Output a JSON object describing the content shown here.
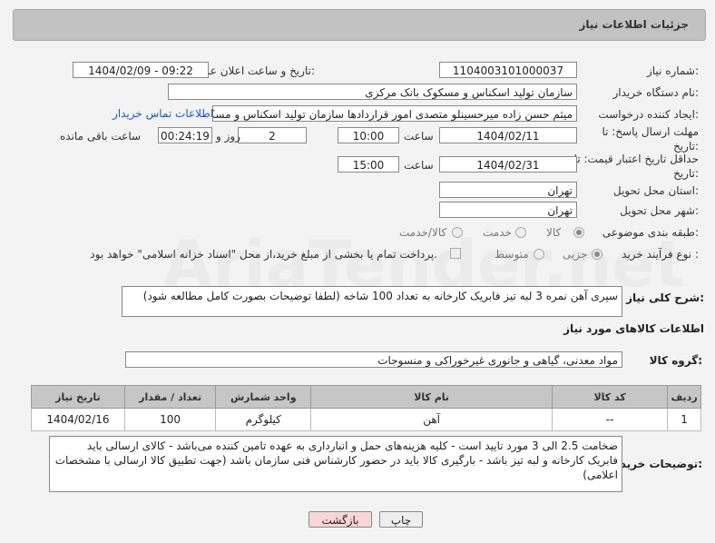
{
  "header": {
    "title": "جزئیات اطلاعات نیاز"
  },
  "form": {
    "need_number_label": "شماره نیاز:",
    "need_number": "1104003101000037",
    "announce_label": "تاریخ و ساعت اعلان عمومی:",
    "announce_value": "1404/02/09 - 09:22",
    "buyer_org_label": "نام دستگاه خریدار:",
    "buyer_org": "سازمان تولید اسکناس و مسکوک بانک مرکزی",
    "requester_label": "ایجاد کننده درخواست:",
    "requester": "میثم حسن زاده میرحسینلو متصدی امور قراردادها سازمان تولید اسکناس و مسکوک بانک مرکزی",
    "buyer_contact_link": "اطلاعات تماس خریدار",
    "deadline_label": "مهلت ارسال پاسخ: تا تاریخ:",
    "deadline_date": "1404/02/11",
    "time_label": "ساعت",
    "deadline_time": "10:00",
    "days_value": "2",
    "days_label": "روز و",
    "remaining_time": "00:24:19",
    "remaining_label": "ساعت باقی مانده",
    "validity_label": "حداقل تاریخ اعتبار قیمت: تا تاریخ:",
    "validity_date": "1404/02/31",
    "validity_time": "15:00",
    "province_label": "استان محل تحویل:",
    "province": "تهران",
    "city_label": "شهر محل تحویل:",
    "city": "تهران",
    "category_label": "طبقه بندی موضوعی:",
    "category_options": [
      "کالا",
      "خدمت",
      "کالا/خدمت"
    ],
    "process_label": "نوع فرآیند خرید :",
    "process_options": [
      "جزیی",
      "متوسط"
    ],
    "payment_note": "پرداخت تمام یا بخشی از مبلغ خرید،از محل \"اسناد خزانه اسلامی\" خواهد بود."
  },
  "description": {
    "label": "شرح کلی نیاز:",
    "text": "سپری آهن نمره 3 لبه تیز فابریک کارخانه به تعداد 100 شاخه (لطفا توضیحات بصورت کامل مطالعه شود)"
  },
  "goods_section": {
    "title": "اطلاعات کالاهای مورد نیاز",
    "group_label": "گروه کالا:",
    "group_value": "مواد معدنی، گیاهی و جانوری غیرخوراکی و منسوجات"
  },
  "table": {
    "headers": [
      "ردیف",
      "کد کالا",
      "نام کالا",
      "واحد شمارش",
      "تعداد / مقدار",
      "تاریخ نیاز"
    ],
    "rows": [
      [
        "1",
        "--",
        "آهن",
        "کیلوگرم",
        "100",
        "1404/02/16"
      ]
    ]
  },
  "buyer_notes": {
    "label": "توضیحات خریدار:",
    "text": "ضخامت 2.5 الی 3 مورد تایید است - کلیه هزینه‌های حمل و انبارداری به عهده تامین کننده می‌باشد - کالای ارسالی باید فابریک کارخانه و لبه تیز باشد - بارگیری کالا باید در حضور کارشناس فنی سازمان باشد (جهت تطبیق کالا ارسالی با مشخصات اعلامی)"
  },
  "buttons": {
    "print": "چاپ",
    "back": "بازگشت"
  },
  "watermark": "AriaTender.net",
  "colors": {
    "back_button_bg": "#f9d6d6",
    "link": "#1a56c9",
    "header_bg": "#c2c2c2"
  }
}
